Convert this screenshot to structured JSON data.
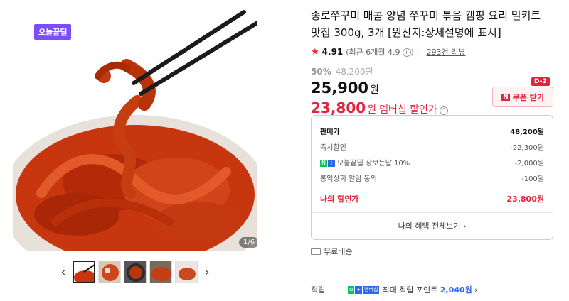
{
  "gallery": {
    "badge": "오늘끝딜",
    "counter": "1/6",
    "prev_icon": "chevron-left-icon",
    "next_icon": "chevron-right-icon",
    "thumbnails": [
      "thumb-1",
      "thumb-2",
      "thumb-3",
      "thumb-4",
      "thumb-5"
    ]
  },
  "product": {
    "title": "종로쭈꾸미 매콤 양념 쭈꾸미 볶음 캠핑 요리 밀키트 맛집 300g, 3개 [원산지:상세설명에 표시]",
    "rating": "4.91",
    "rating_recent": "(최근 6개월 4.9",
    "rating_recent_end": ")",
    "review_count": "293건 리뷰",
    "discount_rate": "50%",
    "original_price": "48,200원",
    "price": "25,900",
    "price_unit": "원",
    "member_price": "23,800",
    "member_unit": "원",
    "member_label": "멤버십 할인가",
    "info_icon": "question-circle-icon"
  },
  "coupon": {
    "dday": "D-2",
    "n_label": "N",
    "label": "쿠폰 받기",
    "accent": "#e0243c"
  },
  "benefit": {
    "rows": [
      {
        "label": "판매가",
        "value": "48,200원"
      },
      {
        "label": "즉시할인",
        "value": "-22,300원"
      },
      {
        "label": "오늘끝딜 장보는날 10%",
        "value": "-2,000원"
      },
      {
        "label": "홍익상회 알림 동의",
        "value": "-100원"
      }
    ],
    "my_price_label": "나의 할인가",
    "my_price_value": "23,800원",
    "view_all": "나의 혜택 전체보기",
    "view_all_icon": "chevron-right-icon"
  },
  "shipping": {
    "icon": "truck-icon",
    "label": "무료배송"
  },
  "points": {
    "label": "적립",
    "badge": "멤버십",
    "text": "최대 적립 포인트",
    "amount": "2,040원",
    "link_icon": "chevron-right-icon"
  },
  "colors": {
    "accent_red": "#e0243c",
    "naver_green": "#03c75a",
    "naver_blue": "#3066e8",
    "badge_purple": "#7b4dff"
  }
}
